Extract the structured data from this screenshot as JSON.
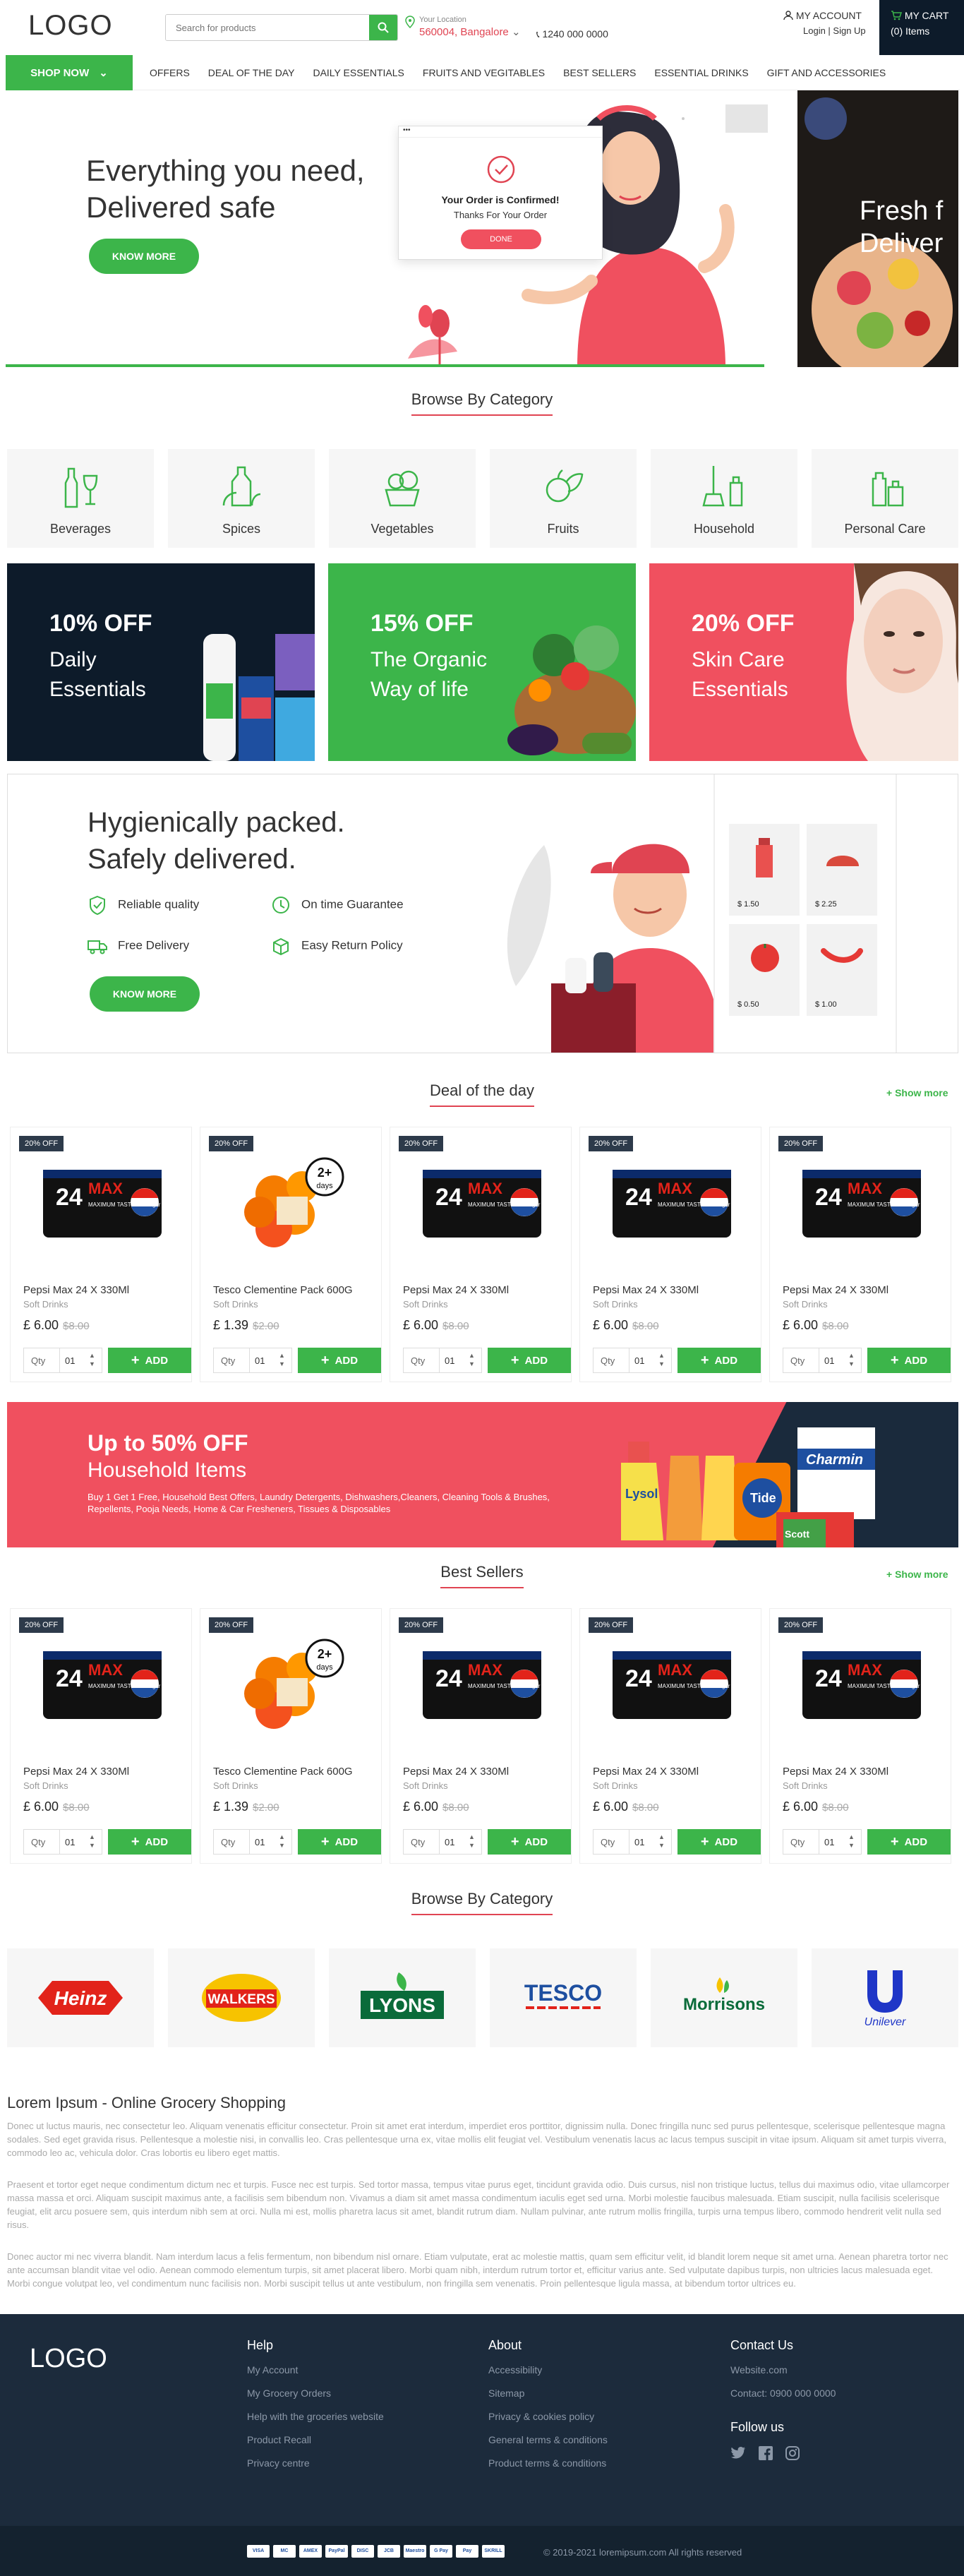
{
  "header": {
    "logo": "LOGO",
    "search_placeholder": "Search for products",
    "location_label": "Your Location",
    "location_city": "560004, Bangalore",
    "phone": "1240 000 0000",
    "account_label": "MY ACCOUNT",
    "account_links": "Login | Sign Up",
    "cart_label": "MY CART",
    "cart_count": "(0) Items"
  },
  "nav": {
    "shop_now": "SHOP NOW",
    "items": [
      "OFFERS",
      "DEAL OF THE DAY",
      "DAILY ESSENTIALS",
      "FRUITS AND VEGITABLES",
      "BEST SELLERS",
      "ESSENTIAL DRINKS",
      "GIFT AND ACCESSORIES"
    ]
  },
  "hero": {
    "line1": "Everything you need,",
    "line2": "Delivered safe",
    "button": "KNOW MORE",
    "popup_title": "Your Order is Confirmed!",
    "popup_sub": "Thanks For Your Order",
    "popup_btn": "DONE",
    "side_line1": "Fresh f",
    "side_line2": "Deliver"
  },
  "categories": {
    "title": "Browse By Category",
    "items": [
      "Beverages",
      "Spices",
      "Vegetables",
      "Fruits",
      "Household",
      "Personal Care"
    ]
  },
  "promos": [
    {
      "off": "10% OFF",
      "line1": "Daily",
      "line2": "Essentials",
      "bg": "#0d1b2a"
    },
    {
      "off": "15% OFF",
      "line1": "The Organic",
      "line2": "Way of life",
      "bg": "#3cb54a"
    },
    {
      "off": "20% OFF",
      "line1": "Skin Care",
      "line2": "Essentials",
      "bg": "#f0505f"
    }
  ],
  "hygiene": {
    "line1": "Hygienically packed.",
    "line2": "Safely delivered.",
    "features": [
      "Reliable quality",
      "On time Guarantee",
      "Free Delivery",
      "Easy Return Policy"
    ],
    "button": "KNOW MORE",
    "prices": [
      "$ 1.50",
      "$ 2.25",
      "$ 0.50",
      "$ 1.00"
    ]
  },
  "deal": {
    "title": "Deal of the day",
    "show_more": "+ Show more"
  },
  "best": {
    "title": "Best Sellers",
    "show_more": "+ Show more"
  },
  "products": [
    {
      "badge": "20% OFF",
      "name": "Pepsi Max 24 X 330Ml",
      "cat": "Soft Drinks",
      "price": "£ 6.00",
      "old": "$8.00",
      "qty_label": "Qty",
      "qty": "01",
      "add": "ADD",
      "kind": "pepsi"
    },
    {
      "badge": "20% OFF",
      "name": "Tesco Clementine Pack 600G",
      "cat": "Soft Drinks",
      "price": "£ 1.39",
      "old": "$2.00",
      "qty_label": "Qty",
      "qty": "01",
      "add": "ADD",
      "kind": "orange"
    },
    {
      "badge": "20% OFF",
      "name": "Pepsi Max 24 X 330Ml",
      "cat": "Soft Drinks",
      "price": "£ 6.00",
      "old": "$8.00",
      "qty_label": "Qty",
      "qty": "01",
      "add": "ADD",
      "kind": "pepsi"
    },
    {
      "badge": "20% OFF",
      "name": "Pepsi Max 24 X 330Ml",
      "cat": "Soft Drinks",
      "price": "£ 6.00",
      "old": "$8.00",
      "qty_label": "Qty",
      "qty": "01",
      "add": "ADD",
      "kind": "pepsi"
    },
    {
      "badge": "20% OFF",
      "name": "Pepsi Max 24 X 330Ml",
      "cat": "Soft Drinks",
      "price": "£ 6.00",
      "old": "$8.00",
      "qty_label": "Qty",
      "qty": "01",
      "add": "ADD",
      "kind": "pepsi"
    }
  ],
  "pepsi_pack": {
    "count": "24",
    "brand": "MAX",
    "tagline": "MAXIMUM TASTE NO sugar"
  },
  "clementine_pack": {
    "line1": "2+",
    "line2": "days"
  },
  "household": {
    "off": "Up to 50% OFF",
    "title": "Household Items",
    "desc": "Buy 1 Get 1 Free, Household Best Offers, Laundry Detergents, Dishwashers,Cleaners, Cleaning Tools & Brushes, Repellents, Pooja Needs, Home & Car Fresheners, Tissues & Disposables",
    "labels": [
      "Lysol",
      "Tide",
      "Charmin",
      "Scott"
    ]
  },
  "brands": {
    "title": "Browse By Category",
    "items": [
      "Heinz",
      "WALKERS",
      "LYONS",
      "TESCO",
      "Morrisons",
      "Unilever"
    ]
  },
  "seo": {
    "title": "Lorem Ipsum - Online Grocery Shopping",
    "p1": "Donec ut luctus mauris, nec consectetur leo. Aliquam venenatis efficitur consectetur. Proin sit amet erat interdum, imperdiet eros porttitor, dignissim nulla. Donec fringilla nunc sed purus pellentesque, scelerisque pellentesque magna sodales. Sed eget gravida risus. Pellentesque a molestie nisi, in convallis leo. Cras pellentesque urna ex, vitae mollis elit feugiat vel. Vestibulum venenatis lacus ac lacus tempus suscipit in vitae ipsum. Aliquam sit amet turpis viverra, commodo leo ac, vehicula dolor. Cras lobortis eu libero eget mattis.",
    "p2": "Praesent et tortor eget neque condimentum dictum nec et turpis. Fusce nec est turpis. Sed tortor massa, tempus vitae purus eget, tincidunt gravida odio. Duis cursus, nisl non tristique luctus, tellus dui maximus odio, vitae ullamcorper massa massa et orci. Aliquam suscipit maximus ante, a facilisis sem bibendum non. Vivamus a diam sit amet massa condimentum iaculis eget sed urna. Morbi molestie faucibus malesuada. Etiam suscipit, nulla facilisis scelerisque feugiat, elit arcu posuere sem, quis interdum nibh sem at orci. Nulla mi est, mollis pharetra lacus sit amet, blandit rutrum diam. Nullam pulvinar, ante rutrum mollis fringilla, turpis urna tempus libero, commodo hendrerit velit nulla sed risus.",
    "p3": "Donec auctor mi nec viverra blandit. Nam interdum lacus a felis fermentum, non bibendum nisl ornare. Etiam vulputate, erat ac molestie mattis, quam sem efficitur velit, id blandit lorem neque sit amet urna. Aenean pharetra tortor nec ante accumsan blandit vitae vel odio. Aenean commodo elementum turpis, sit amet placerat libero. Morbi quam nibh, interdum rutrum tortor et, efficitur varius ante. Sed vulputate dapibus turpis, non ultricies lacus malesuada eget. Morbi congue volutpat leo, vel condimentum nunc facilisis non. Morbi suscipit tellus ut ante vestibulum, non fringilla sem venenatis. Proin pellentesque ligula massa, at bibendum tortor ultrices eu."
  },
  "footer": {
    "logo": "LOGO",
    "help_title": "Help",
    "help": [
      "My Account",
      "My Grocery Orders",
      "Help with the groceries website",
      "Product Recall",
      "Privacy centre"
    ],
    "about_title": "About",
    "about": [
      "Accessibility",
      "Sitemap",
      "Privacy & cookies policy",
      "General terms & conditions",
      "Product terms & conditions"
    ],
    "contact_title": "Contact Us",
    "contact": [
      "Website.com",
      "Contact: 0900 000 0000"
    ],
    "follow_title": "Follow us",
    "payments": [
      "VISA",
      "MC",
      "AMEX",
      "PayPal",
      "DISC",
      "JCB",
      "Maestro",
      "G Pay",
      "Pay",
      "SKRILL"
    ],
    "copyright": "© 2019-2021 loremipsum.com All rights reserved"
  },
  "colors": {
    "green": "#3cb54a",
    "navy": "#0d1b2a",
    "coral": "#f0505f"
  }
}
